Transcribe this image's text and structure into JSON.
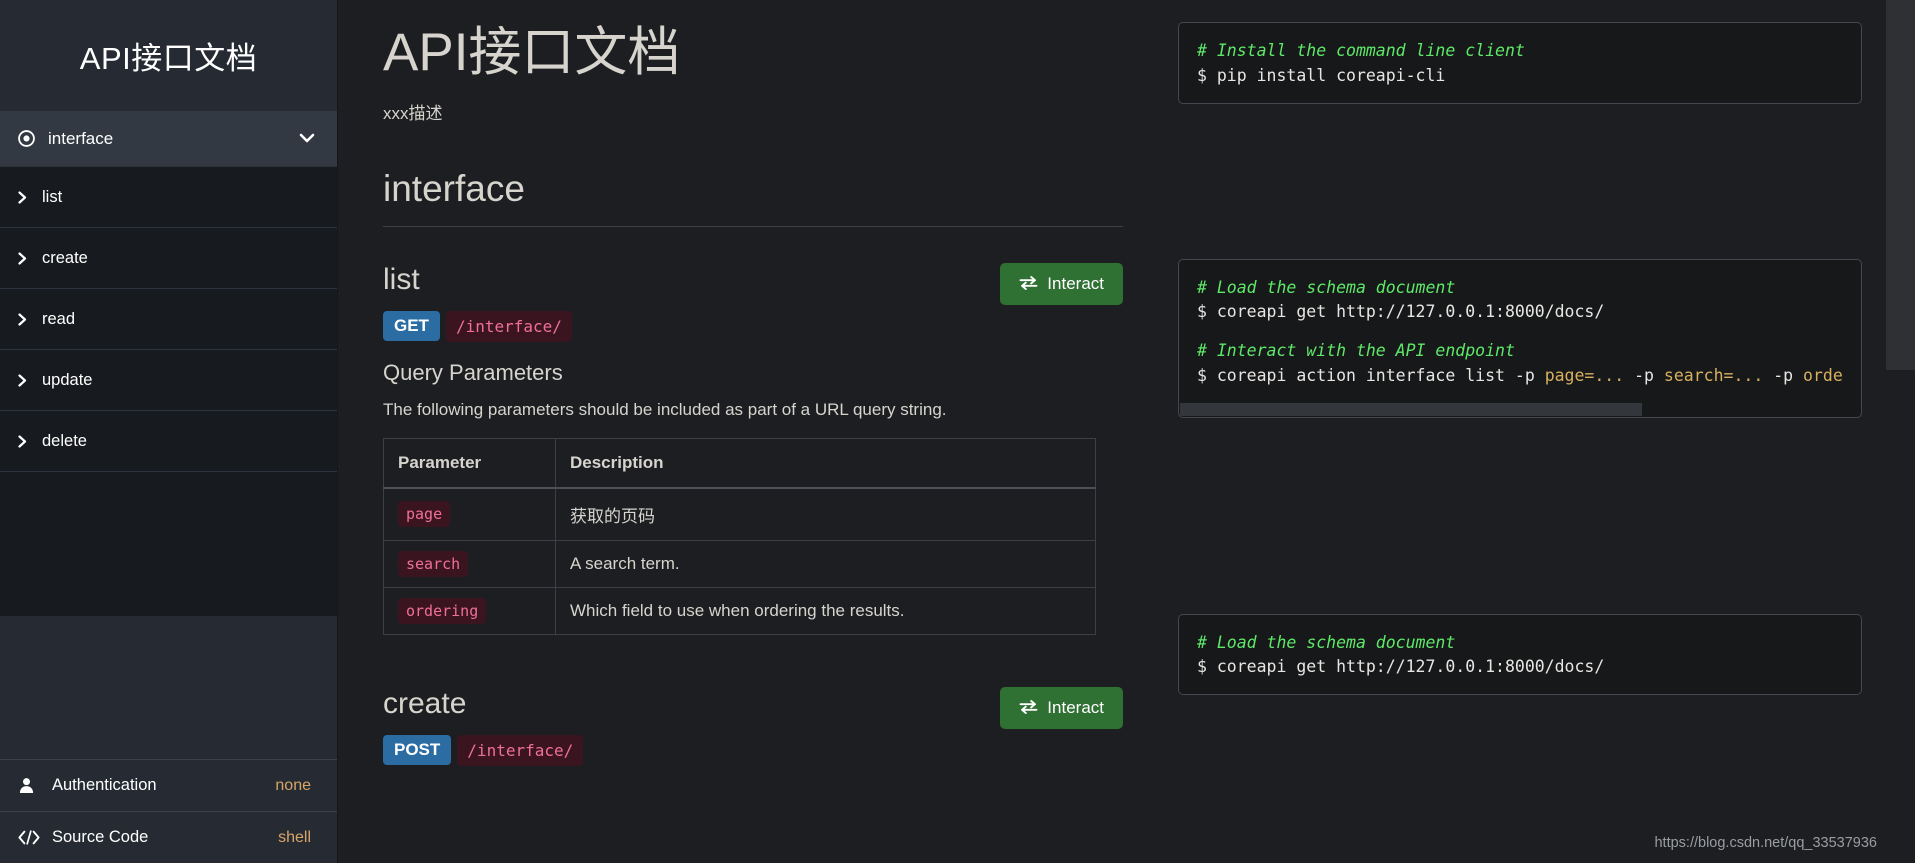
{
  "sidebar": {
    "brand": "API接口文档",
    "group": {
      "icon": "record-circle-icon",
      "label": "interface",
      "chevron": "chevron-down-icon"
    },
    "items": [
      {
        "label": "list"
      },
      {
        "label": "create"
      },
      {
        "label": "read"
      },
      {
        "label": "update"
      },
      {
        "label": "delete"
      }
    ],
    "footer": [
      {
        "icon": "user-icon",
        "label": "Authentication",
        "value": "none"
      },
      {
        "icon": "code-icon",
        "label": "Source Code",
        "value": "shell"
      }
    ]
  },
  "main": {
    "title": "API接口文档",
    "description": "xxx描述",
    "section_heading": "interface",
    "interact_label": "Interact",
    "links": [
      {
        "name": "list",
        "method": "GET",
        "url": "/interface/",
        "params_heading": "Query Parameters",
        "params_note": "The following parameters should be included as part of a URL query string.",
        "table": {
          "headers": [
            "Parameter",
            "Description"
          ],
          "rows": [
            {
              "param": "page",
              "description": "获取的页码"
            },
            {
              "param": "search",
              "description": "A search term."
            },
            {
              "param": "ordering",
              "description": "Which field to use when ordering the results."
            }
          ]
        }
      },
      {
        "name": "create",
        "method": "POST",
        "url": "/interface/"
      }
    ]
  },
  "code": {
    "install": {
      "comment": "# Install the command line client",
      "command": "$ pip install coreapi-cli"
    },
    "list_panel": {
      "comment1": "# Load the schema document",
      "command1": "$ coreapi get http://127.0.0.1:8000/docs/",
      "comment2": "# Interact with the API endpoint",
      "command2_prefix": "$ coreapi action interface list -p ",
      "command2_p1": "page=...",
      "command2_mid1": " -p ",
      "command2_p2": "search=...",
      "command2_mid2": " -p ",
      "command2_p3": "orde"
    },
    "create_panel": {
      "comment1": "# Load the schema document",
      "command1": "$ coreapi get http://127.0.0.1:8000/docs/"
    }
  },
  "watermark": "https://blog.csdn.net/qq_33537936"
}
